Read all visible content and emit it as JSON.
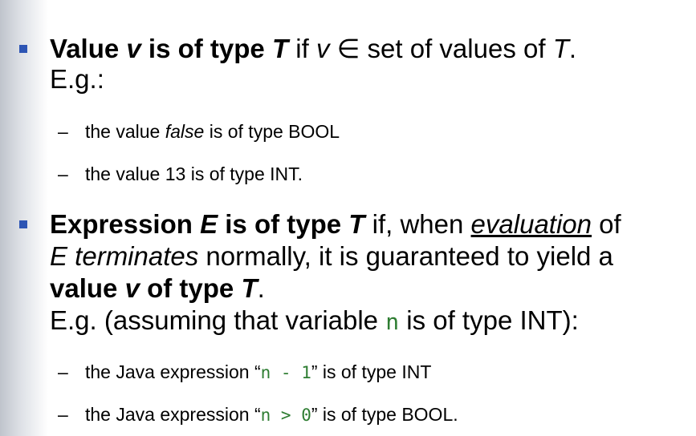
{
  "item1": {
    "line1": {
      "bold_a": "Value ",
      "bold_v": "v",
      "bold_b": " is of type ",
      "bold_T": "T",
      "rest_a": " if ",
      "v": "v",
      "rest_b": " ∈ set of values of ",
      "T": "T",
      "end": "."
    },
    "line2": "E.g.:",
    "sub1": {
      "dash": "–",
      "a": "the value ",
      "em": "false",
      "b": " is of type BOOL"
    },
    "sub2": {
      "dash": "–",
      "text": "the value 13 is of type INT."
    }
  },
  "item2": {
    "line1": {
      "bold_a": "Expression ",
      "bold_E": "E",
      "bold_b": " is of type ",
      "bold_T": "T",
      "rest_a": " if, when ",
      "eval": "evaluation",
      "rest_b": " of"
    },
    "line2": {
      "em": "E terminates",
      "rest": " normally, it is guaranteed to yield a"
    },
    "line3": {
      "bold_a": "value ",
      "bold_v": "v",
      "bold_b": " of type ",
      "bold_T": "T",
      "end": "."
    },
    "line4": {
      "a": "E.g. (assuming that variable ",
      "code": "n",
      "b": " is of type INT):"
    },
    "sub1": {
      "dash": "–",
      "a": "the Java expression “",
      "code": "n - 1",
      "b": "” is of type INT"
    },
    "sub2": {
      "dash": "–",
      "a": "the Java expression “",
      "code": "n > 0",
      "b": "” is of type BOOL."
    }
  }
}
